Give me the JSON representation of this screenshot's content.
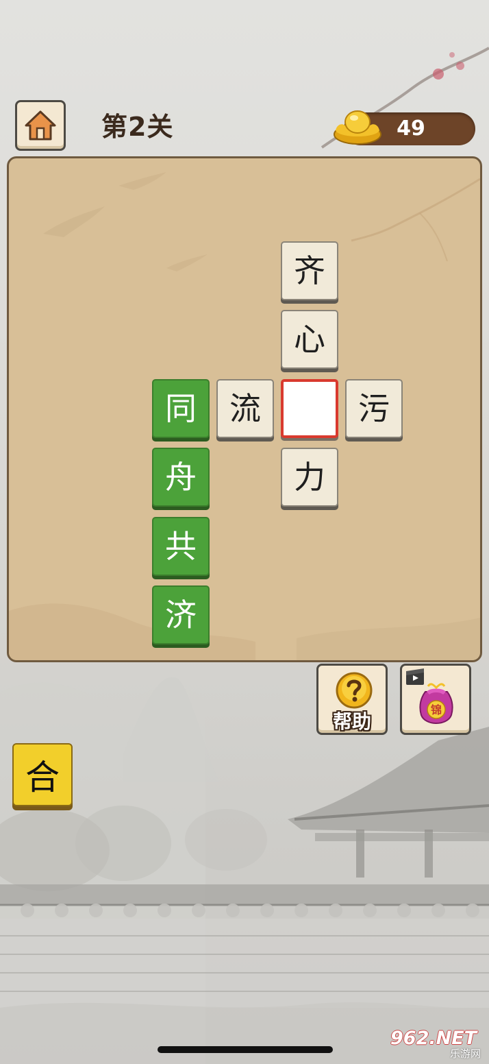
{
  "header": {
    "level_title": "第2关",
    "coins": "49",
    "home_icon": "home-icon",
    "coin_icon": "gold-ingot-icon"
  },
  "board": {
    "tiles": [
      {
        "char": "齐",
        "style": "fixed"
      },
      {
        "char": "心",
        "style": "fixed"
      },
      {
        "char": "同",
        "style": "green"
      },
      {
        "char": "流",
        "style": "fixed"
      },
      {
        "char": "",
        "style": "target"
      },
      {
        "char": "污",
        "style": "fixed"
      },
      {
        "char": "力",
        "style": "fixed"
      },
      {
        "char": "舟",
        "style": "green"
      },
      {
        "char": "共",
        "style": "green"
      },
      {
        "char": "济",
        "style": "green"
      }
    ]
  },
  "actions": {
    "help_label": "帮助",
    "help_icon": "question-mark-icon",
    "bag_icon": "lucky-bag-video-icon",
    "bag_text": "锦"
  },
  "answer_choice": {
    "char": "合"
  },
  "watermark": {
    "main": "962.NET",
    "sub": "乐游网"
  },
  "colors": {
    "board_bg": "#d8bf97",
    "green_tile": "#4ca23a",
    "target_border": "#d93a2e",
    "merge_tile": "#f2cf2b",
    "coin_pill": "#6d4428"
  }
}
